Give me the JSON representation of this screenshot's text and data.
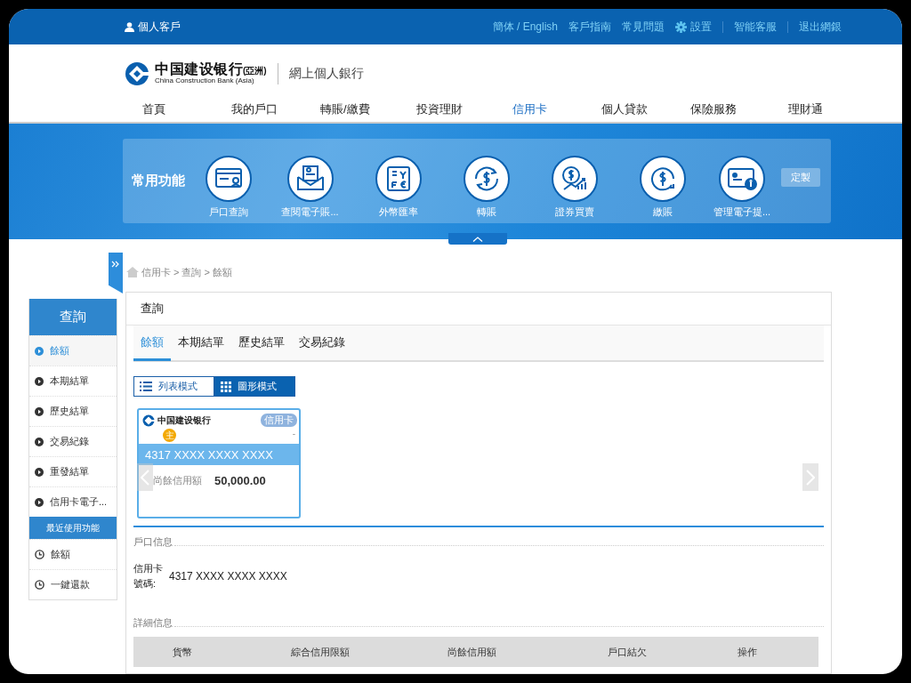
{
  "top_bar": {
    "user": "個人客戶",
    "links": [
      {
        "label": "簡体 / English",
        "kind": "text",
        "divider": false
      },
      {
        "label": "客戶指南",
        "kind": "text",
        "divider": false
      },
      {
        "label": "常見問題",
        "kind": "text",
        "divider": false
      },
      {
        "label": "設置",
        "kind": "settings",
        "divider": false
      },
      {
        "label": "智能客服",
        "kind": "text",
        "divider": true
      },
      {
        "label": "退出網銀",
        "kind": "text",
        "divider": true
      }
    ]
  },
  "header": {
    "logo_name": "中国建设银行",
    "logo_region": "(亞洲)",
    "logo_english": "China Construction Bank (Asia)",
    "site_title": "網上個人銀行"
  },
  "nav": [
    {
      "label": "首頁",
      "selected": false
    },
    {
      "label": "我的戶口",
      "selected": false
    },
    {
      "label": "轉賬/繳費",
      "selected": false
    },
    {
      "label": "投資理財",
      "selected": false
    },
    {
      "label": "信用卡",
      "selected": true
    },
    {
      "label": "個人貸款",
      "selected": false
    },
    {
      "label": "保險服務",
      "selected": false
    },
    {
      "label": "理財通",
      "selected": false
    }
  ],
  "quick_functions": {
    "title": "常用功能",
    "customize": "定製",
    "items": [
      {
        "label": "戶口查詢",
        "kind": "card"
      },
      {
        "label": "查閱電子賬...",
        "kind": "envelope"
      },
      {
        "label": "外幣匯率",
        "kind": "currency"
      },
      {
        "label": "轉賬",
        "kind": "transfer"
      },
      {
        "label": "證券買賣",
        "kind": "stock"
      },
      {
        "label": "繳賬",
        "kind": "pay"
      },
      {
        "label": "管理電子提...",
        "kind": "ebill"
      }
    ]
  },
  "sidebar": {
    "title": "查詢",
    "items": [
      {
        "label": "餘額",
        "selected": true
      },
      {
        "label": "本期結單",
        "selected": false
      },
      {
        "label": "歷史結單",
        "selected": false
      },
      {
        "label": "交易紀錄",
        "selected": false
      },
      {
        "label": "重發結單",
        "selected": false
      },
      {
        "label": "信用卡電子...",
        "selected": false
      }
    ],
    "recent_title": "最近使用功能",
    "recent": [
      "餘額",
      "一鍵還款"
    ]
  },
  "breadcrumb": {
    "items": [
      "信用卡",
      "查詢",
      "餘額"
    ],
    "separator": ">"
  },
  "main": {
    "title": "查詢",
    "tabs": [
      {
        "label": "餘額",
        "selected": true
      },
      {
        "label": "本期結單",
        "selected": false
      },
      {
        "label": "歷史結單",
        "selected": false
      },
      {
        "label": "交易紀錄",
        "selected": false
      }
    ],
    "view_modes": [
      {
        "label": "列表模式",
        "kind": "list",
        "selected": false
      },
      {
        "label": "圖形模式",
        "kind": "grid",
        "selected": true
      }
    ],
    "card": {
      "bank": "中国建设银行",
      "badge": "信用卡",
      "primary": "主",
      "dash": "-",
      "number": "4317 XXXX XXXX XXXX",
      "balance_label": "尚餘信用額",
      "balance": "50,000.00"
    },
    "account_section": {
      "title": "戶口信息",
      "field_label": "信用卡號碼:",
      "field_value": "4317 XXXX XXXX XXXX"
    },
    "detail_section": {
      "title": "詳細信息",
      "columns": [
        "貨幣",
        "綜合信用限額",
        "尚餘信用額",
        "戶口結欠",
        "操作"
      ]
    }
  }
}
